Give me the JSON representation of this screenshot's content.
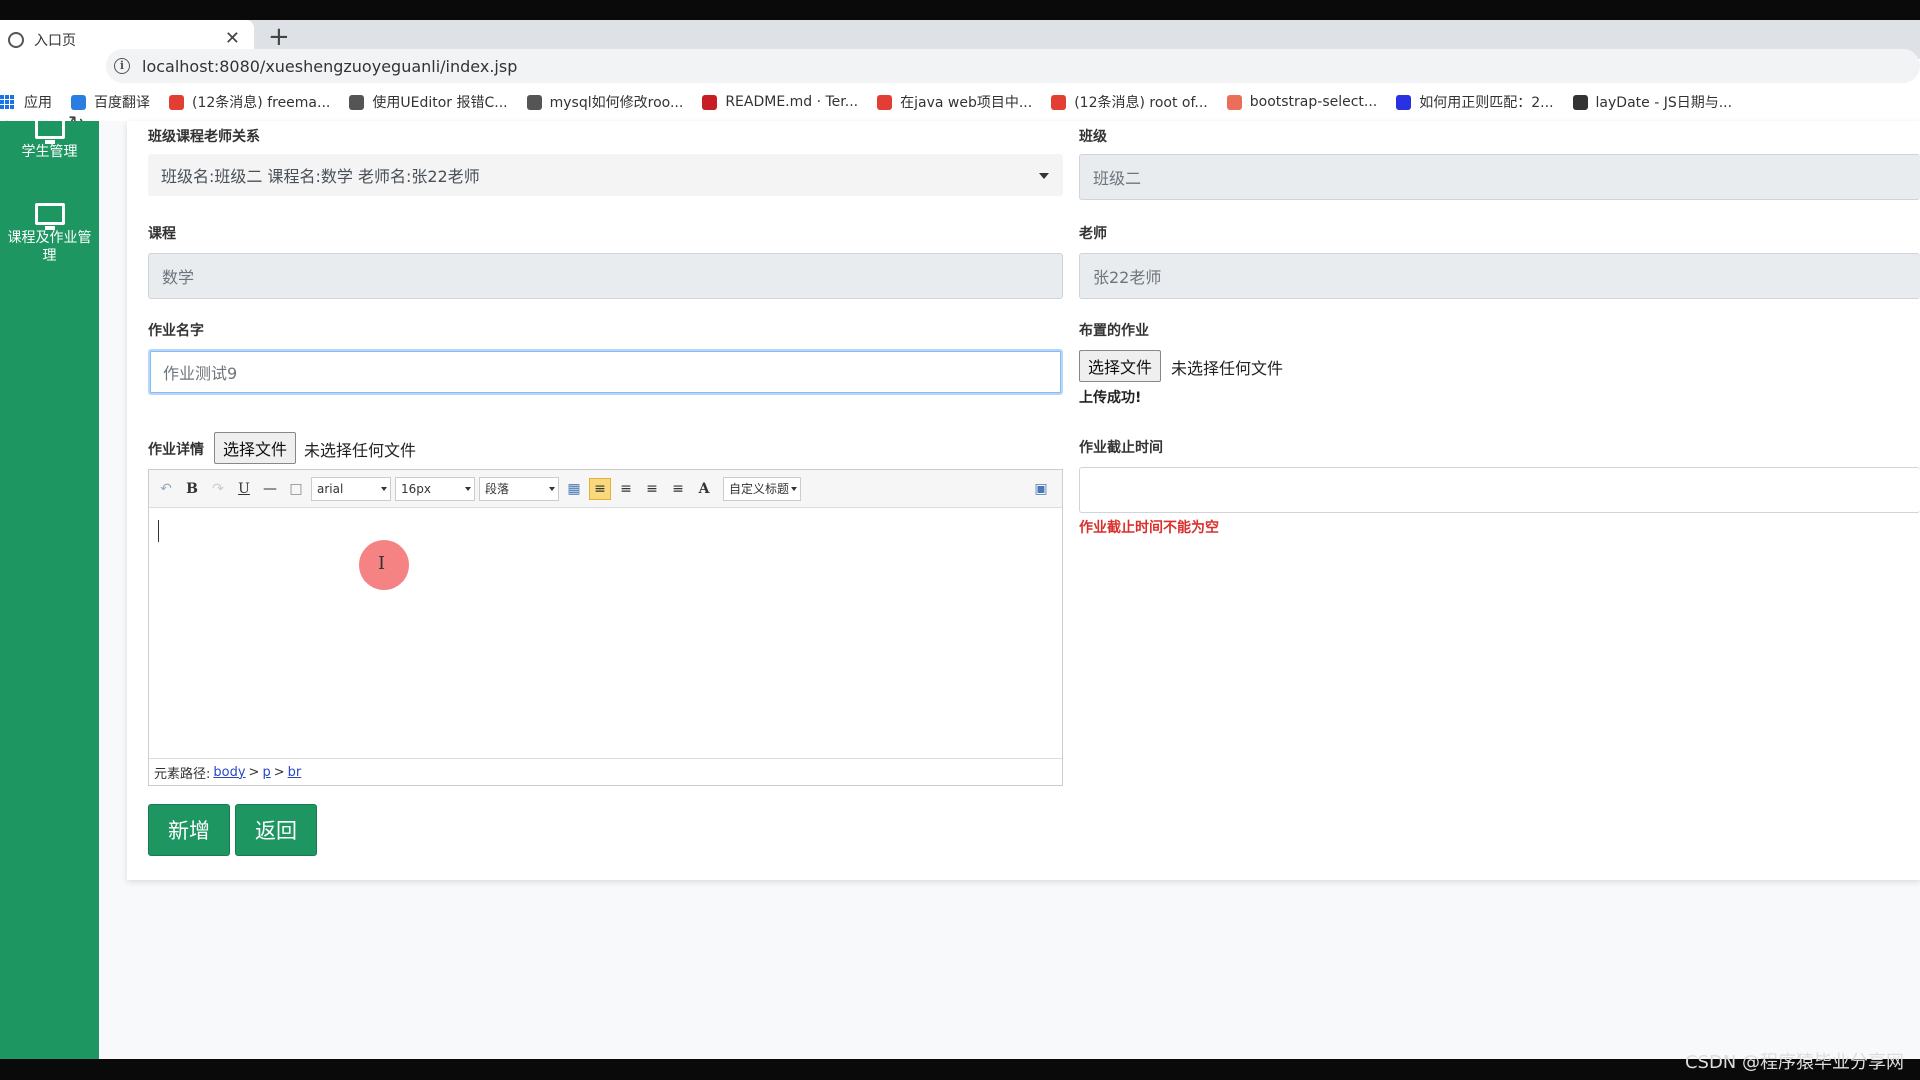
{
  "browser": {
    "tab_title": "入口页",
    "new_tab_symbol": "+",
    "close_symbol": "✕",
    "url": "localhost:8080/xueshengzuoyeguanli/index.jsp",
    "bookmarks": [
      {
        "label": "应用",
        "icon": "apps-grid-icon",
        "color": "#1a73e8"
      },
      {
        "label": "百度翻译",
        "icon": "baidu-translate-icon",
        "color": "#2a7de1"
      },
      {
        "label": "(12条消息) freema...",
        "icon": "csdn-icon",
        "color": "#e33e33"
      },
      {
        "label": "使用UEditor 报错C...",
        "icon": "link-icon",
        "color": "#555555"
      },
      {
        "label": "mysql如何修改roo...",
        "icon": "link-icon",
        "color": "#555555"
      },
      {
        "label": "README.md · Ter...",
        "icon": "gitee-icon",
        "color": "#c71d23"
      },
      {
        "label": "在java web项目中...",
        "icon": "csdn-icon",
        "color": "#e33e33"
      },
      {
        "label": "(12条消息) root of...",
        "icon": "csdn-icon",
        "color": "#e33e33"
      },
      {
        "label": "bootstrap-select...",
        "icon": "jianshu-icon",
        "color": "#ea6f5a"
      },
      {
        "label": "如何用正则匹配：2...",
        "icon": "baidu-paw-icon",
        "color": "#2932e1"
      },
      {
        "label": "layDate - JS日期与...",
        "icon": "laydate-icon",
        "color": "#333333"
      }
    ]
  },
  "sidebar": {
    "items": [
      {
        "label": "学生管理"
      },
      {
        "label": "课程及作业管理"
      }
    ]
  },
  "form": {
    "relation_label": "班级课程老师关系",
    "relation_value": "班级名:班级二 课程名:数学 老师名:张22老师",
    "class_label": "班级",
    "class_value": "班级二",
    "course_label": "课程",
    "course_value": "数学",
    "teacher_label": "老师",
    "teacher_value": "张22老师",
    "hw_name_label": "作业名字",
    "hw_name_value": "作业测试9",
    "assigned_label": "布置的作业",
    "choose_file_label": "选择文件",
    "no_file_text": "未选择任何文件",
    "upload_success": "上传成功!",
    "detail_label": "作业详情",
    "deadline_label": "作业截止时间",
    "deadline_error": "作业截止时间不能为空",
    "submit_label": "新增",
    "back_label": "返回"
  },
  "editor": {
    "font_family": "arial",
    "font_size": "16px",
    "paragraph": "段落",
    "custom_title": "自定义标题",
    "path_prefix": "元素路径:",
    "path": [
      "body",
      "p",
      "br"
    ],
    "path_sep": ">",
    "bold": "B",
    "underline": "U",
    "font_color": "A"
  },
  "cursor_icon": "I",
  "watermark": "CSDN @程序猿毕业分享网"
}
